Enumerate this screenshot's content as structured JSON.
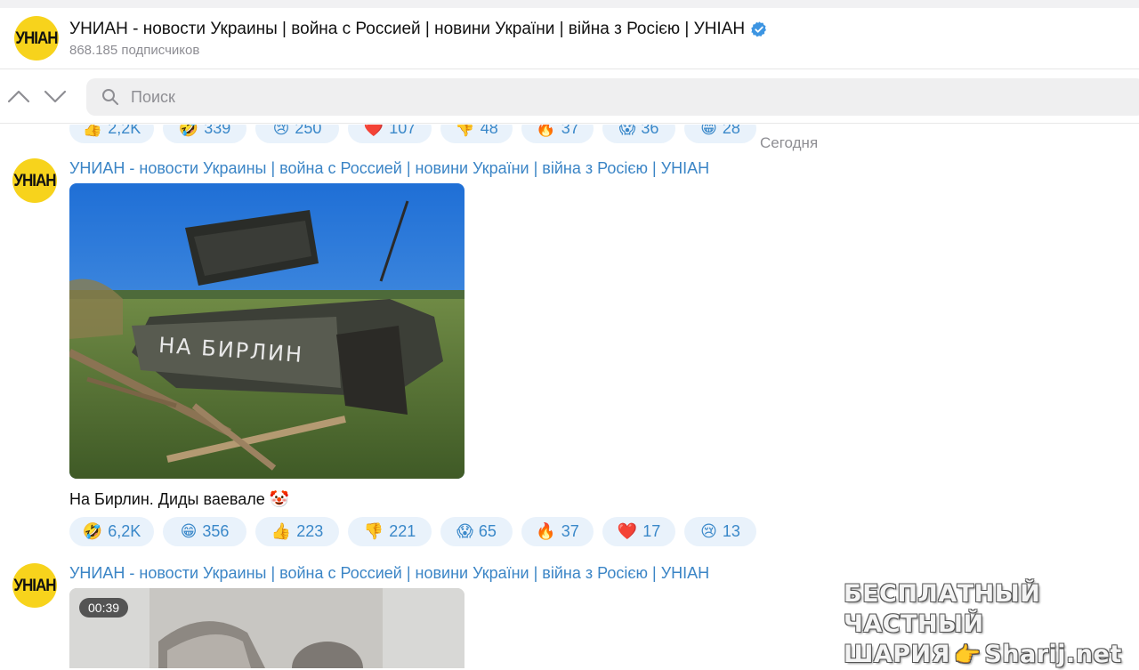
{
  "channel": {
    "title": "УНИАН - новости Украины | война с Россией | новини України | війна з Росією | УНІАН",
    "subscribers": "868.185 подписчиков",
    "avatar_text": "УНІАН",
    "verified_icon": "verified-badge-icon"
  },
  "search": {
    "placeholder": "Поиск"
  },
  "feed": {
    "prev_reactions": [
      {
        "emoji": "👍",
        "count": "2,2K"
      },
      {
        "emoji": "🤣",
        "count": "339"
      },
      {
        "emoji": "😢",
        "count": "250"
      },
      {
        "emoji": "❤️",
        "count": "107"
      },
      {
        "emoji": "👎",
        "count": "48"
      },
      {
        "emoji": "🔥",
        "count": "37"
      },
      {
        "emoji": "😱",
        "count": "36"
      },
      {
        "emoji": "😁",
        "count": "28"
      }
    ],
    "date_separator": "Сегодня",
    "post1": {
      "author": "УНИАН - новости Украины | война с Россией | новини України | війна з Росією | УНІАН",
      "photo_text": "НА БИРЛИН",
      "caption": "На Бирлин. Диды ваевале 🤡",
      "reactions": [
        {
          "emoji": "🤣",
          "count": "6,2K"
        },
        {
          "emoji": "😁",
          "count": "356"
        },
        {
          "emoji": "👍",
          "count": "223"
        },
        {
          "emoji": "👎",
          "count": "221"
        },
        {
          "emoji": "😱",
          "count": "65"
        },
        {
          "emoji": "🔥",
          "count": "37"
        },
        {
          "emoji": "❤️",
          "count": "17"
        },
        {
          "emoji": "😢",
          "count": "13"
        }
      ]
    },
    "post2": {
      "author": "УНИАН - новости Украины | война с Россией | новини України | війна з Росією | УНІАН",
      "video_duration": "00:39"
    }
  },
  "watermark": {
    "line1": "БЕСПЛАТНЫЙ ЧАСТНЫЙ",
    "line2a": "ШАРИЯ",
    "line2b": "Sharij.net"
  },
  "colors": {
    "accent": "#3b85c6",
    "reaction_bg": "#e9f2fb",
    "avatar_yellow": "#f7d31c"
  }
}
